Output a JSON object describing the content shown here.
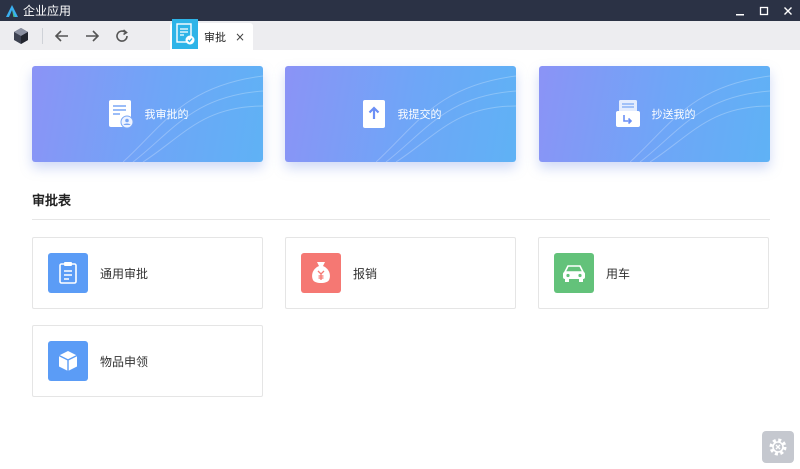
{
  "window": {
    "title": "企业应用"
  },
  "tab": {
    "label": "审批",
    "close": "×"
  },
  "cards": [
    {
      "label": "我审批的",
      "icon": "approval-doc-icon"
    },
    {
      "label": "我提交的",
      "icon": "submit-upload-icon"
    },
    {
      "label": "抄送我的",
      "icon": "cc-forward-icon"
    }
  ],
  "section": {
    "title": "审批表"
  },
  "items": [
    {
      "label": "通用审批",
      "color": "#5b9cf6",
      "icon": "clipboard-icon"
    },
    {
      "label": "报销",
      "color": "#f57873",
      "icon": "money-bag-icon"
    },
    {
      "label": "用车",
      "color": "#63c27a",
      "icon": "car-icon"
    },
    {
      "label": "物品申领",
      "color": "#5b9cf6",
      "icon": "box-icon"
    }
  ],
  "colors": {
    "titlebar": "#2b3245",
    "toolbar": "#ededf0",
    "tab_icon": "#2eb4e8",
    "card_gradient_start": "#8b93f6",
    "card_gradient_end": "#5fb2f5"
  }
}
